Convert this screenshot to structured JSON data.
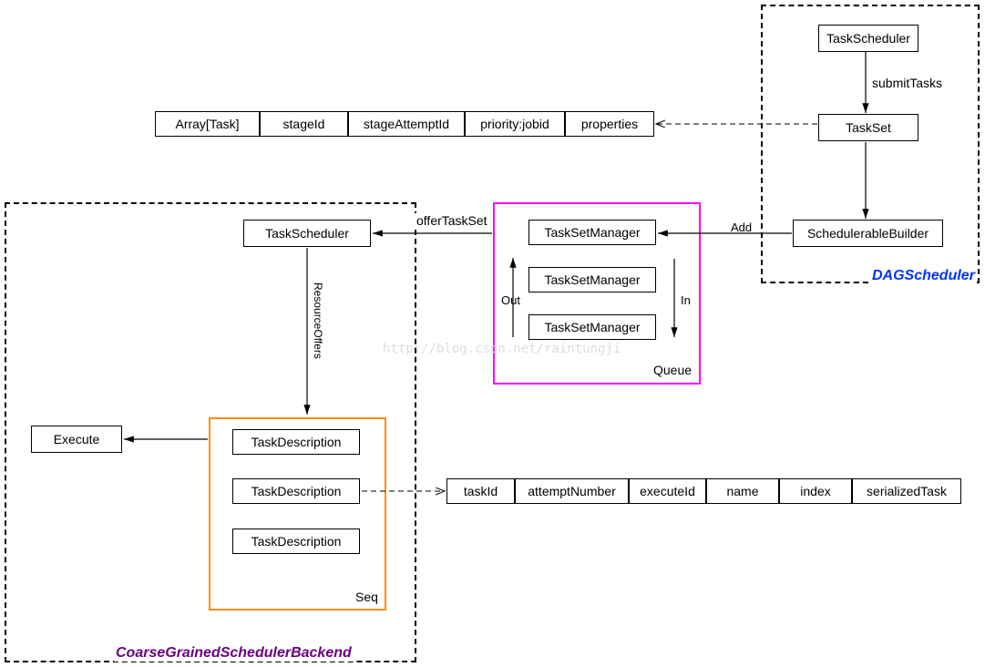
{
  "dag": {
    "title": "DAGScheduler",
    "taskScheduler": "TaskScheduler",
    "submitTasks": "submitTasks",
    "taskSet": "TaskSet",
    "builder": "SchedulerableBuilder"
  },
  "taskSetFields": {
    "f1": "Array[Task]",
    "f2": "stageId",
    "f3": "stageAttemptId",
    "f4": "priority:jobid",
    "f5": "properties"
  },
  "queue": {
    "label": "Queue",
    "items": [
      "TaskSetManager",
      "TaskSetManager",
      "TaskSetManager"
    ],
    "in": "In",
    "out": "Out",
    "add": "Add"
  },
  "backend": {
    "title": "CoarseGrainedSchedulerBackend",
    "taskScheduler": "TaskScheduler",
    "offerTaskSet": "offerTaskSet",
    "resourceOffers": "ResourceOffers",
    "seqLabel": "Seq",
    "seqItems": [
      "TaskDescription",
      "TaskDescription",
      "TaskDescription"
    ],
    "execute": "Execute"
  },
  "taskDescFields": {
    "f1": "taskId",
    "f2": "attemptNumber",
    "f3": "executeId",
    "f4": "name",
    "f5": "index",
    "f6": "serializedTask"
  },
  "watermark": "http://blog.csdn.net/raintungji"
}
